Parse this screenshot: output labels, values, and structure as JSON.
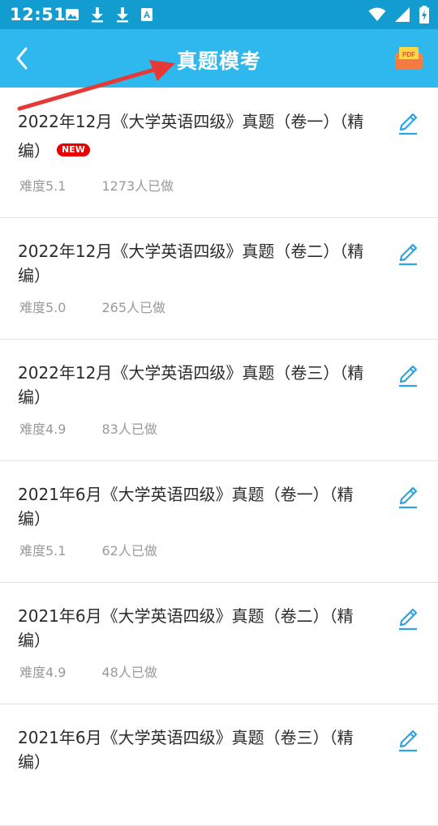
{
  "status_bar": {
    "time": "12:51",
    "left_icons": [
      "image-icon",
      "download-icon",
      "download-icon",
      "text-icon"
    ],
    "right_icons": [
      "wifi-icon",
      "signal-icon",
      "battery-charging-icon"
    ]
  },
  "app_bar": {
    "title": "真题模考",
    "back_icon": "chevron-left-icon",
    "action_icon": "pdf-icon",
    "action_icon_text": "PDF"
  },
  "colors": {
    "status_bar": "#139ccf",
    "app_bar": "#2eb8ee",
    "edit_icon": "#2aa4e6",
    "badge": "#e60000",
    "annotation_arrow": "#e53935"
  },
  "list": {
    "items": [
      {
        "title": "2022年12月《大学英语四级》真题（卷一）（精编）",
        "badge": "NEW",
        "difficulty": "难度5.1",
        "plays": "1273人已做"
      },
      {
        "title": "2022年12月《大学英语四级》真题（卷二）（精编）",
        "badge": "",
        "difficulty": "难度5.0",
        "plays": "265人已做"
      },
      {
        "title": "2022年12月《大学英语四级》真题（卷三）（精编）",
        "badge": "",
        "difficulty": "难度4.9",
        "plays": "83人已做"
      },
      {
        "title": "2021年6月《大学英语四级》真题（卷一）（精编）",
        "badge": "",
        "difficulty": "难度5.1",
        "plays": "62人已做"
      },
      {
        "title": "2021年6月《大学英语四级》真题（卷二）（精编）",
        "badge": "",
        "difficulty": "难度4.9",
        "plays": "48人已做"
      },
      {
        "title": "2021年6月《大学英语四级》真题（卷三）（精编）",
        "badge": "",
        "difficulty": "",
        "plays": ""
      }
    ]
  }
}
